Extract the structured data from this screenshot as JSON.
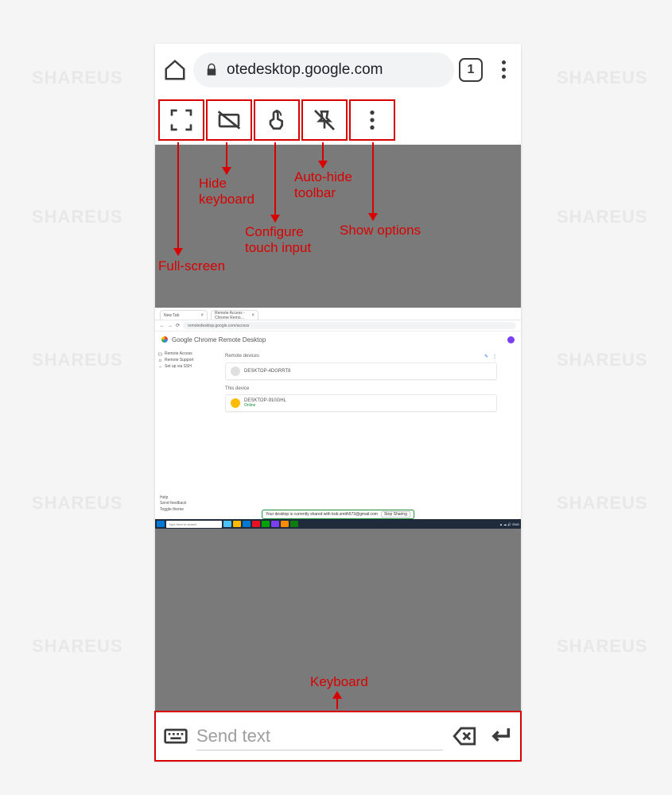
{
  "browser": {
    "url": "otedesktop.google.com",
    "tab_count": "1"
  },
  "annotations": {
    "fullscreen": "Full-screen",
    "hide_keyboard": "Hide\nkeyboard",
    "configure_touch": "Configure\ntouch input",
    "autohide": "Auto-hide\ntoolbar",
    "show_options": "Show options",
    "keyboard": "Keyboard"
  },
  "remote": {
    "app_title": "Google Chrome Remote Desktop",
    "tab1": "New Tab",
    "tab2": "Remote Access - Chrome Remo…",
    "url": "remotedesktop.google.com/access",
    "side_items": [
      "Remote Access",
      "Remote Support",
      "Set up via SSH"
    ],
    "section1": "Remote devices",
    "device1": "DESKTOP-4DGRRT8",
    "section2": "This device",
    "device2": "DESKTOP-910GHL",
    "device2_status": "Online",
    "help_items": [
      "Help",
      "Send feedback",
      "Toggle theme"
    ],
    "sharing_msg": "Your desktop is currently shared with bob.smith573@gmail.com",
    "stop": "Stop Sharing",
    "taskbar_search": "Type here to search"
  },
  "keyboard_bar": {
    "placeholder": "Send text"
  },
  "watermark": "SHAREUS"
}
